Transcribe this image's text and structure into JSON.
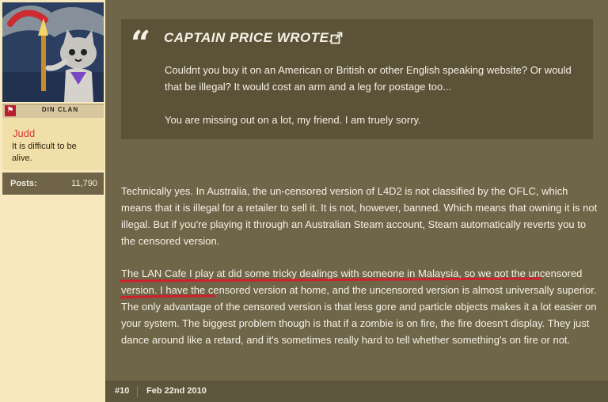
{
  "sidebar": {
    "clan_name": "DIN CLAN",
    "username": "Judd",
    "user_title": "It is difficult to be alive.",
    "stats": [
      {
        "label": "Posts:",
        "value": "11,790"
      }
    ]
  },
  "post": {
    "quote": {
      "author": "CAPTAIN PRICE WROTE:",
      "paragraphs": [
        "Couldnt you buy it on an American or British or other English speaking website? Or would that be illegal? It would cost an arm and a leg for postage too...",
        "You are missing out on a lot, my friend. I am truely sorry."
      ]
    },
    "paragraphs": [
      "Technically yes. In Australia, the un-censored version of L4D2 is not classified by the OFLC, which means that it is illegal for a retailer to sell it. It is not, however, banned. Which means that owning it is not illegal. But if you're playing it through an Australian Steam account, Steam automatically reverts you to the censored version.",
      "The LAN Cafe I play at did some tricky dealings with someone in Malaysia, so we got the uncensored version. I have the censored version at home, and the uncensored version is almost universally superior. The only advantage of the censored version is that less gore and particle objects makes it a lot easier on your system. The biggest problem though is that if a zombie is on fire, the fire doesn't display. They just dance around like a retard, and it's sometimes really hard to tell whether something's on fire or not."
    ],
    "post_number": "#10",
    "date": "Feb 22nd 2010"
  },
  "colors": {
    "post_bg": "#6f6549",
    "quote_bg": "#5b5238",
    "sidebar_bg": "#f7e9bd",
    "username": "#d73b38",
    "annotation": "#d11f2b"
  },
  "icons": [
    "quote-mark-icon",
    "external-link-icon",
    "clan-flag-icon",
    "avatar-image"
  ]
}
